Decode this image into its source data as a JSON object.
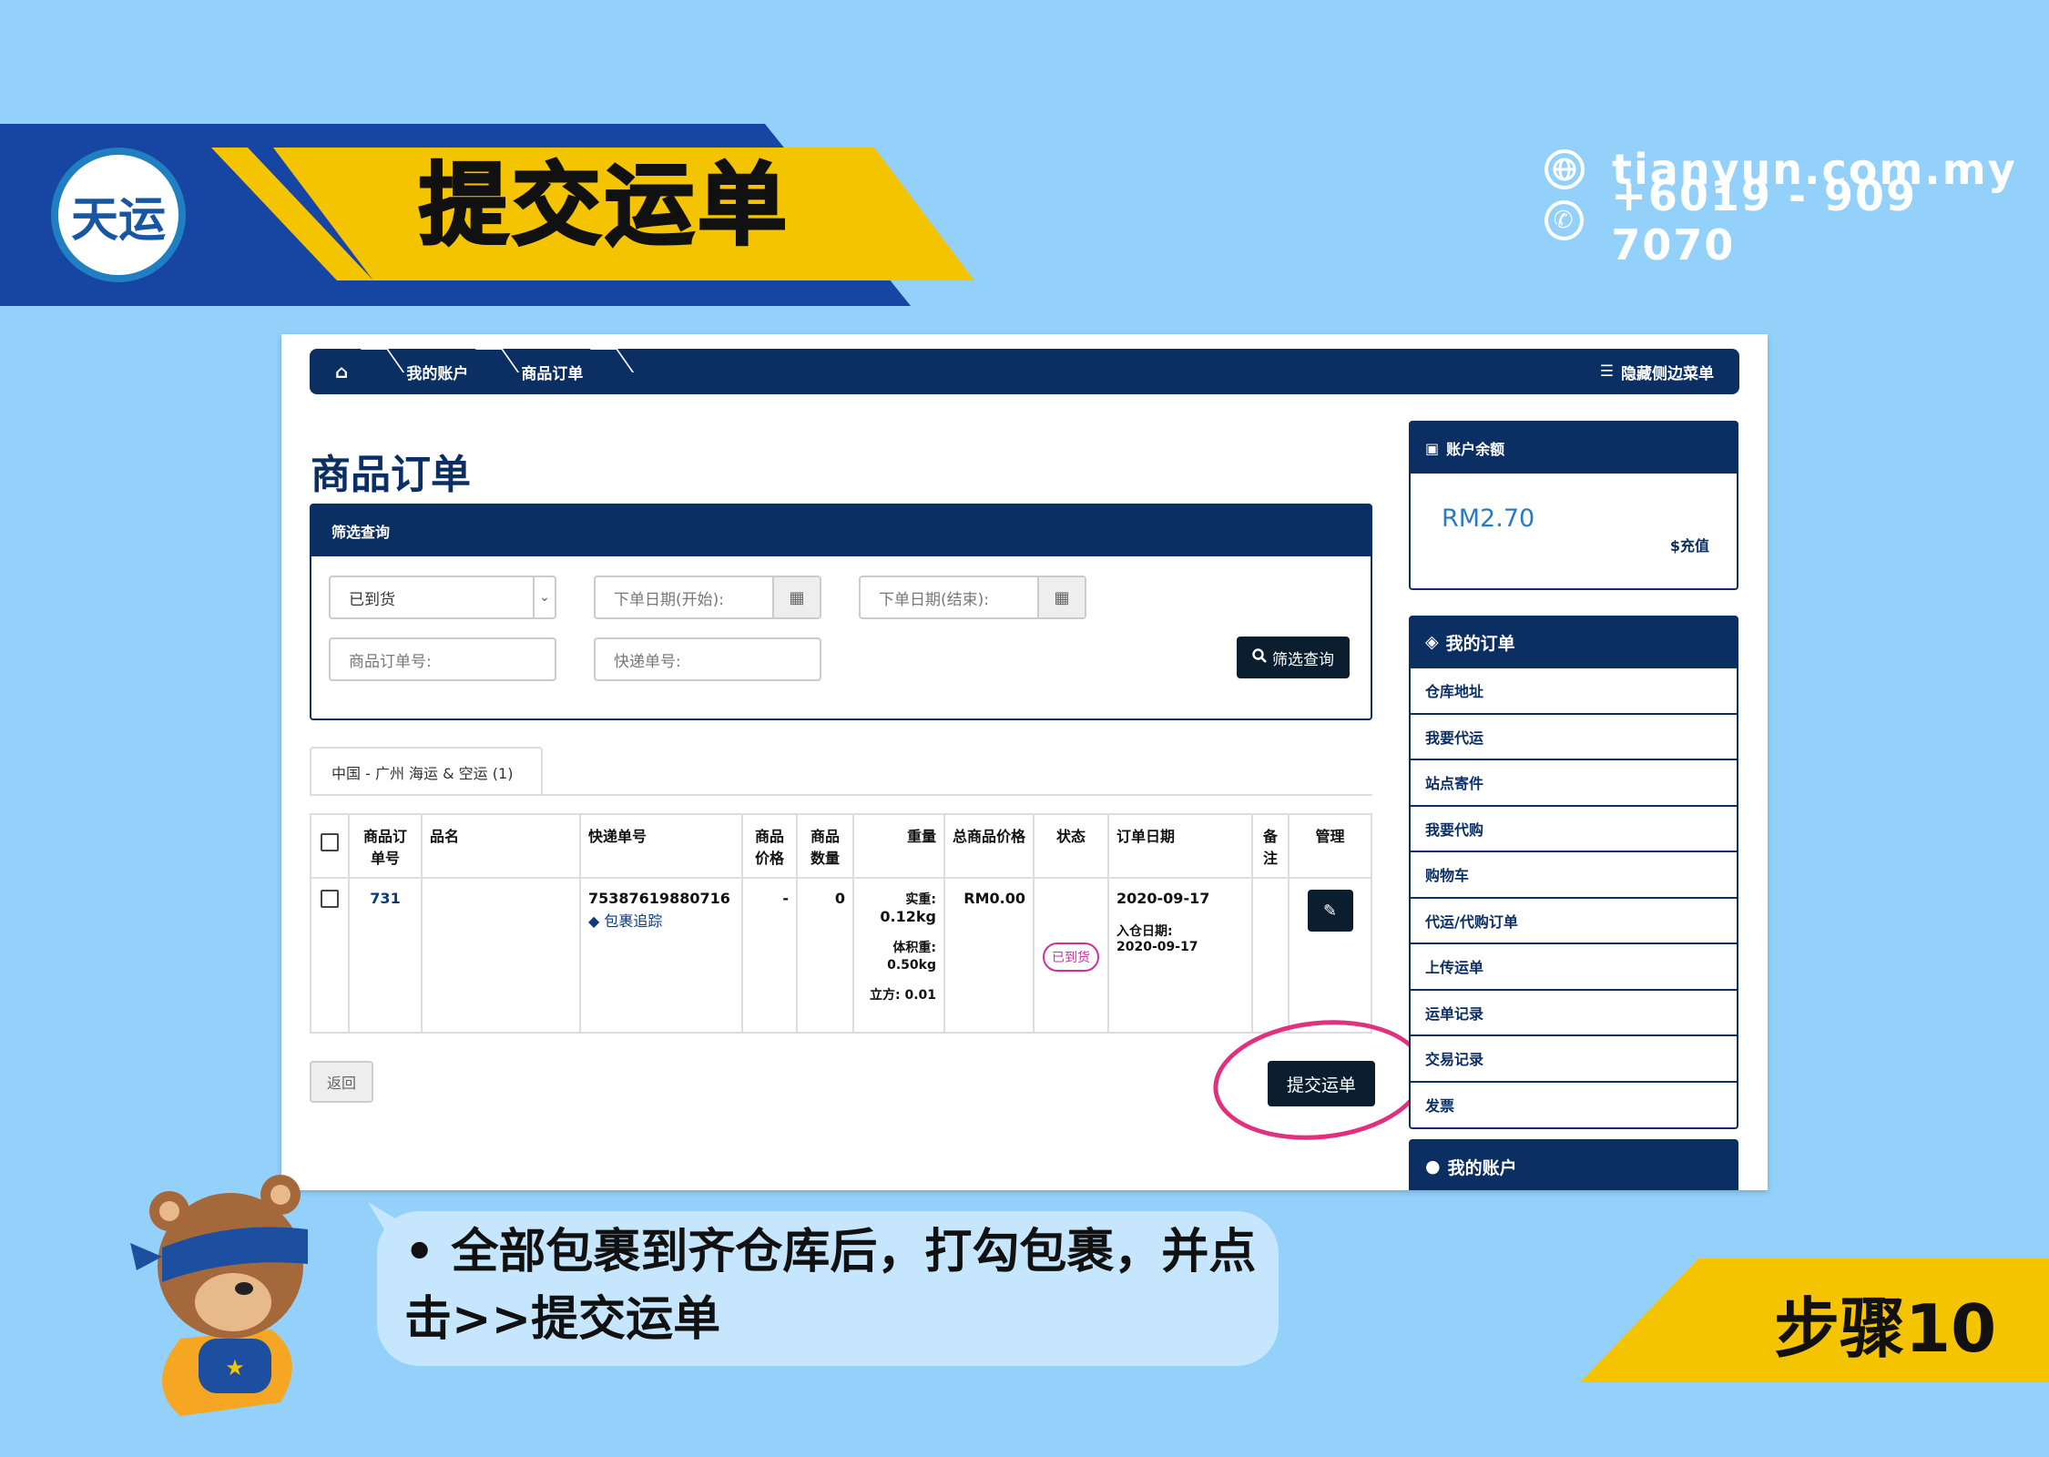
{
  "banner": {
    "logo_text": "天运",
    "title": "提交运单",
    "website": "tianyun.com.my",
    "phone": "+6019 - 909 7070"
  },
  "breadcrumb": {
    "home_icon": "home-icon",
    "items": [
      "我的账户",
      "商品订单"
    ],
    "hide_menu": "隐藏侧边菜单"
  },
  "page_title": "商品订单",
  "filter": {
    "heading": "筛选查询",
    "status_value": "已到货",
    "date_start_placeholder": "下单日期(开始):",
    "date_end_placeholder": "下单日期(结束):",
    "order_no_placeholder": "商品订单号:",
    "tracking_no_placeholder": "快递单号:",
    "search_label": "筛选查询"
  },
  "tab": {
    "label": "中国 - 广州 海运 & 空运 (1)"
  },
  "table": {
    "headers": [
      "商品订单号",
      "品名",
      "快递单号",
      "商品价格",
      "商品数量",
      "重量",
      "总商品价格",
      "状态",
      "订单日期",
      "备注",
      "管理"
    ],
    "row": {
      "order_no": "731",
      "name": "",
      "tracking_no": "75387619880716",
      "track_link": "包裹追踪",
      "price": "-",
      "qty": "0",
      "weight_actual_label": "实重:",
      "weight_actual": "0.12kg",
      "weight_vol_label": "体积重:",
      "weight_vol": "0.50kg",
      "cubic_label": "立方:",
      "cubic": "0.01",
      "total_price": "RM0.00",
      "status": "已到货",
      "order_date": "2020-09-17",
      "in_date_label": "入仓日期:",
      "in_date": "2020-09-17",
      "note": ""
    }
  },
  "buttons": {
    "back": "返回",
    "submit": "提交运单"
  },
  "sidebar": {
    "balance_title": "账户余额",
    "balance_value": "RM2.70",
    "recharge": "$充值",
    "orders_title": "我的订单",
    "menu": [
      "仓库地址",
      "我要代运",
      "站点寄件",
      "我要代购",
      "购物车",
      "代运/代购订单",
      "上传运单",
      "运单记录",
      "交易记录",
      "发票"
    ],
    "account_title": "我的账户"
  },
  "instruction": "• 全部包裹到齐仓库后，打勾包裹，并点击>>提交运单",
  "step": "步骤10",
  "colors": {
    "navy": "#0c2f63",
    "banner_blue": "#1745a3",
    "yellow": "#f5c400",
    "background": "#93d1fb",
    "highlight": "#e0307e"
  }
}
